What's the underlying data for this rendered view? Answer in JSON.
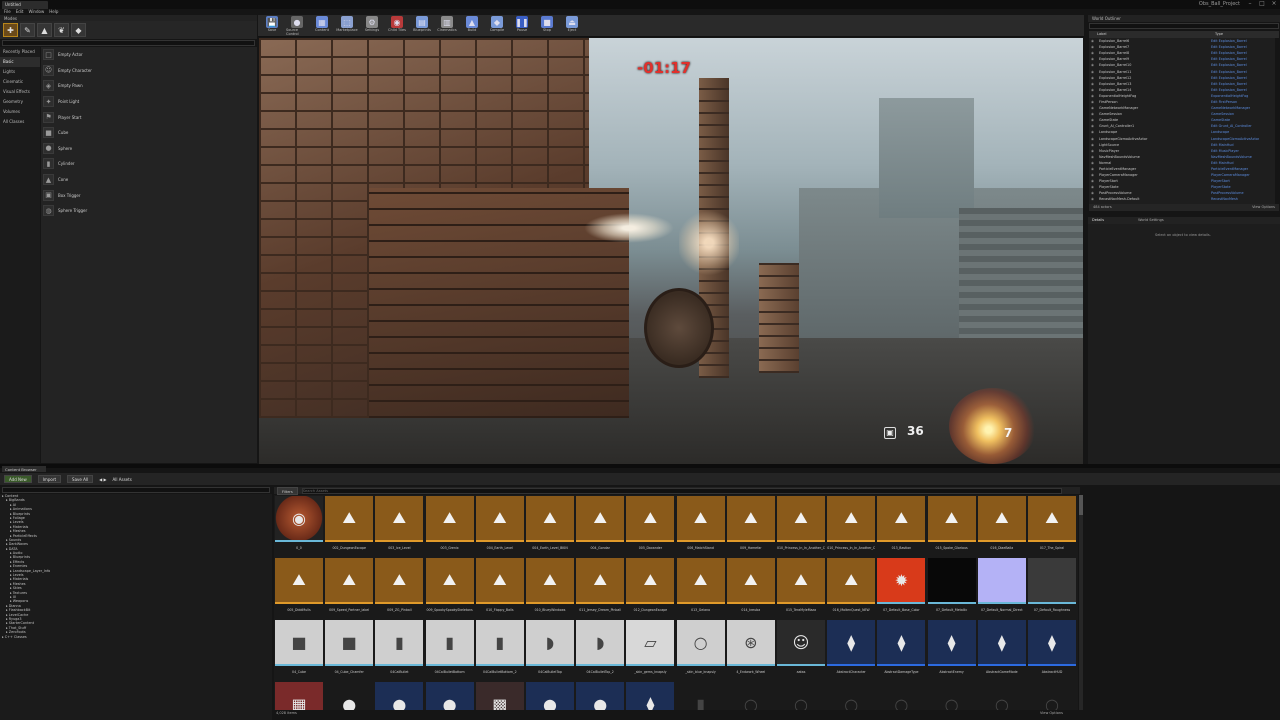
{
  "window": {
    "tab": "Untitled",
    "project": "Obs_Ball_Project",
    "min": "–",
    "max": "□",
    "close": "×"
  },
  "menu": [
    "File",
    "Edit",
    "Window",
    "Help"
  ],
  "modes": {
    "title": "Modes",
    "icons": [
      "place-icon",
      "paint-icon",
      "landscape-icon",
      "foliage-icon",
      "geometry-icon"
    ]
  },
  "place": {
    "categories": [
      "Recently Placed",
      "Basic",
      "Lights",
      "Cinematic",
      "Visual Effects",
      "Geometry",
      "Volumes",
      "All Classes"
    ],
    "selected_index": 1,
    "items": [
      "Empty Actor",
      "Empty Character",
      "Empty Pawn",
      "Point Light",
      "Player Start",
      "Cube",
      "Sphere",
      "Cylinder",
      "Cone",
      "Box Trigger",
      "Sphere Trigger"
    ]
  },
  "toolbar": [
    {
      "label": "Save",
      "color": "#5b7ec4",
      "icon": "💾"
    },
    {
      "label": "Source Control",
      "color": "#666",
      "icon": "●"
    },
    {
      "label": "Content",
      "color": "#6a8ad8",
      "icon": "▦"
    },
    {
      "label": "Marketplace",
      "color": "#8aa0d0",
      "icon": "⬚"
    },
    {
      "label": "Settings",
      "color": "#888",
      "icon": "⚙"
    },
    {
      "label": "Child Tiles",
      "color": "#b83a3a",
      "icon": "◉"
    },
    {
      "label": "Blueprints",
      "color": "#7a9ad8",
      "icon": "▤"
    },
    {
      "label": "Cinematics",
      "color": "#8a8a8a",
      "icon": "▥"
    },
    {
      "label": "Build",
      "color": "#6a8ad8",
      "icon": "▲"
    },
    {
      "label": "Compile",
      "color": "#7a9ad8",
      "icon": "◆"
    },
    {
      "label": "Pause",
      "color": "#3a5ec4",
      "icon": "❚❚"
    },
    {
      "label": "Stop",
      "color": "#5a7ad0",
      "icon": "■"
    },
    {
      "label": "Eject",
      "color": "#7a9ad8",
      "icon": "⏏"
    }
  ],
  "viewport": {
    "timer": "-01:17",
    "ammo": "36",
    "orb_count": "7",
    "ammo_icon": "▣"
  },
  "outliner": {
    "title": "World Outliner",
    "col_label": "Label",
    "col_type": "Type",
    "rows": [
      [
        "Explosion_Barrel6",
        "Edit Explosion_Barrel"
      ],
      [
        "Explosion_Barrel7",
        "Edit Explosion_Barrel"
      ],
      [
        "Explosion_Barrel8",
        "Edit Explosion_Barrel"
      ],
      [
        "Explosion_Barrel9",
        "Edit Explosion_Barrel"
      ],
      [
        "Explosion_Barrel10",
        "Edit Explosion_Barrel"
      ],
      [
        "Explosion_Barrel11",
        "Edit Explosion_Barrel"
      ],
      [
        "Explosion_Barrel12",
        "Edit Explosion_Barrel"
      ],
      [
        "Explosion_Barrel13",
        "Edit Explosion_Barrel"
      ],
      [
        "Explosion_Barrel14",
        "Edit Explosion_Barrel"
      ],
      [
        "ExponentialHeightFog",
        "ExponentialHeightFog"
      ],
      [
        "FirstPerson",
        "Edit FirstPerson"
      ],
      [
        "GameNetworkManager",
        "GameNetworkManager"
      ],
      [
        "GameSession",
        "GameSession"
      ],
      [
        "GameState",
        "GameState"
      ],
      [
        "Grunt_AI_Controller1",
        "Edit Grunt_AI_Controller"
      ],
      [
        "Landscape",
        "Landscape"
      ],
      [
        "LandscapeGizmoActiveActor",
        "LandscapeGizmoActiveActor"
      ],
      [
        "LightSource",
        "Edit MainHud"
      ],
      [
        "MusicPlayer",
        "Edit MusicPlayer"
      ],
      [
        "NavMeshBoundsVolume",
        "NavMeshBoundsVolume"
      ],
      [
        "Normal",
        "Edit MainHud"
      ],
      [
        "ParticleEventManager",
        "ParticleEventManager"
      ],
      [
        "PlayerCameraManager",
        "PlayerCameraManager"
      ],
      [
        "PlayerStart",
        "PlayerStart"
      ],
      [
        "PlayerState",
        "PlayerState"
      ],
      [
        "PostProcessVolume",
        "PostProcessVolume"
      ],
      [
        "RecastNavMesh-Default",
        "RecastNavMesh"
      ],
      [
        "SM_Env_Ins_Buildings_Stairs2",
        "StaticMeshActor"
      ]
    ],
    "footer": "484 actors",
    "view_options": "View Options"
  },
  "details": {
    "tabs": [
      "Details",
      "World Settings"
    ],
    "message": "Select an object to view details."
  },
  "content_browser": {
    "tab": "Content Browser",
    "buttons": [
      "Add New",
      "Import",
      "Save All"
    ],
    "path": "All Assets",
    "tree": [
      "Content",
      "BigBands",
      "AI",
      "Animations",
      "Blueprints",
      "Foliage",
      "Levels",
      "Materials",
      "Meshes",
      "ParticleEffects",
      "Sounds",
      "DarkWaves",
      "DATA",
      "Audio",
      "Blueprints",
      "Effects",
      "Enemies",
      "Landscape_Layer_Info",
      "Levels",
      "Materials",
      "Meshes",
      "Skies",
      "Textures",
      "UI",
      "Weapons",
      "Dianna",
      "FlashbackBit",
      "LevelCache",
      "Ryuga3",
      "StarterContent",
      "That_Stuff",
      "ZeroFoots",
      "C++ Classes"
    ],
    "filter_label": "Filters",
    "search_placeholder": "Search Assets",
    "rows": [
      [
        {
          "label": "0_0",
          "thumb": "sphere-tex",
          "bg": "#7a3c24"
        },
        {
          "label": "002_DungeonEscape",
          "thumb": "map",
          "bg": "#8a5a1a"
        },
        {
          "label": "003_Ice_Level",
          "thumb": "map",
          "bg": "#8a5a1a"
        },
        {
          "label": "003_Grenix",
          "thumb": "map",
          "bg": "#8a5a1a"
        },
        {
          "label": "004_Earth_Level",
          "thumb": "map",
          "bg": "#8a5a1a"
        },
        {
          "label": "004_Earth_Level_BKIN",
          "thumb": "map",
          "bg": "#8a5a1a"
        },
        {
          "label": "004_Gondar",
          "thumb": "map",
          "bg": "#8a5a1a"
        },
        {
          "label": "005_Daxander",
          "thumb": "map",
          "bg": "#8a5a1a"
        },
        {
          "label": "006_MatchStand",
          "thumb": "map",
          "bg": "#8a5a1a"
        },
        {
          "label": "009_Hamefar",
          "thumb": "map",
          "bg": "#8a5a1a"
        },
        {
          "label": "010_Princess_In_In_Another_Castle",
          "thumb": "map",
          "bg": "#8a5a1a"
        },
        {
          "label": "010_Princess_In_In_Another_Castle",
          "thumb": "map",
          "bg": "#8a5a1a"
        },
        {
          "label": "013_Bastion",
          "thumb": "map",
          "bg": "#8a5a1a"
        },
        {
          "label": "015_Spoke_Glorious",
          "thumb": "map",
          "bg": "#8a5a1a"
        },
        {
          "label": "016_DiaeBalla",
          "thumb": "map",
          "bg": "#8a5a1a"
        },
        {
          "label": "017_The_Spiral",
          "thumb": "map",
          "bg": "#8a5a1a"
        }
      ],
      [
        {
          "label": "005_DiddMulls",
          "thumb": "map",
          "bg": "#8a5a1a"
        },
        {
          "label": "009_Speed_Partner_label",
          "thumb": "map",
          "bg": "#8a5a1a"
        },
        {
          "label": "009_ZG_Pinball",
          "thumb": "map",
          "bg": "#8a5a1a"
        },
        {
          "label": "009_SpookySpookySkeletons",
          "thumb": "map",
          "bg": "#8a5a1a"
        },
        {
          "label": "010_Floppy_Balls",
          "thumb": "map",
          "bg": "#8a5a1a"
        },
        {
          "label": "010_BlueyWindows",
          "thumb": "map",
          "bg": "#8a5a1a"
        },
        {
          "label": "011_Jersey_Dream_Pinball",
          "thumb": "map",
          "bg": "#8a5a1a"
        },
        {
          "label": "012_DungeonEscape",
          "thumb": "map",
          "bg": "#8a5a1a"
        },
        {
          "label": "013_Geiano",
          "thumb": "map",
          "bg": "#8a5a1a"
        },
        {
          "label": "014_kreuba",
          "thumb": "map",
          "bg": "#8a5a1a"
        },
        {
          "label": "015_TeraMyleMaza",
          "thumb": "map",
          "bg": "#8a5a1a"
        },
        {
          "label": "016_MoltenQuest_NEW",
          "thumb": "map",
          "bg": "#8a5a1a"
        },
        {
          "label": "07_Default_Base_Color",
          "thumb": "fire",
          "bg": "#d83a1a"
        },
        {
          "label": "07_Default_Metallic",
          "thumb": "dark",
          "bg": "#080808"
        },
        {
          "label": "07_Default_Normal_Direct",
          "thumb": "normal",
          "bg": "#b4b2f6"
        },
        {
          "label": "07_Default_Roughness",
          "thumb": "grey",
          "bg": "#3a3a3a"
        }
      ],
      [
        {
          "label": "04_Cube",
          "thumb": "cube",
          "bg": "#cfcfcf"
        },
        {
          "label": "04_Cube_Chamfer",
          "thumb": "cube",
          "bg": "#cfcfcf"
        },
        {
          "label": "04CalBullet",
          "thumb": "cyl",
          "bg": "#cfcfcf"
        },
        {
          "label": "04CalBulletBottom",
          "thumb": "cyl",
          "bg": "#cfcfcf"
        },
        {
          "label": "04CalBulletBottom_2",
          "thumb": "cyl",
          "bg": "#cfcfcf"
        },
        {
          "label": "04CalBulletTop",
          "thumb": "dome",
          "bg": "#cfcfcf"
        },
        {
          "label": "04CalBulletTop_2",
          "thumb": "dome",
          "bg": "#cfcfcf"
        },
        {
          "label": "_skin_gems_knapsly",
          "thumb": "plane",
          "bg": "#d8d8d8"
        },
        {
          "label": "_skin_blue_knapsly",
          "thumb": "ring",
          "bg": "#cfcfcf"
        },
        {
          "label": "4_Endwork_Wheel",
          "thumb": "wheel",
          "bg": "#cfcfcf"
        },
        {
          "label": "aatas",
          "thumb": "face",
          "bg": "#2a2a2a"
        },
        {
          "label": "AbstractCharacter",
          "thumb": "bp",
          "bg": "#1c2e55"
        },
        {
          "label": "AbstractDamageType",
          "thumb": "bp",
          "bg": "#1c2e55"
        },
        {
          "label": "AbstractEnemy",
          "thumb": "bp",
          "bg": "#1c2e55"
        },
        {
          "label": "AbstractGameMode",
          "thumb": "bp",
          "bg": "#1c2e55"
        },
        {
          "label": "AbstractHUD",
          "thumb": "bp",
          "bg": "#1c2e55"
        }
      ],
      [
        {
          "label": "",
          "thumb": "brick",
          "bg": "#7a2a2a"
        },
        {
          "label": "",
          "thumb": "sphere",
          "bg": "#1a1a1a"
        },
        {
          "label": "",
          "thumb": "sphere",
          "bg": "#1c2e55"
        },
        {
          "label": "",
          "thumb": "sphere",
          "bg": "#1c2e55"
        },
        {
          "label": "",
          "thumb": "tex",
          "bg": "#3a2a2a"
        },
        {
          "label": "",
          "thumb": "sphere",
          "bg": "#1c2e55"
        },
        {
          "label": "",
          "thumb": "sphere",
          "bg": "#1c2e55"
        },
        {
          "label": "",
          "thumb": "bp",
          "bg": "#1c2e55"
        },
        {
          "label": "",
          "thumb": "cyl",
          "bg": "#1a1a1a"
        },
        {
          "label": "",
          "thumb": "ring",
          "bg": "#1a1a1a"
        },
        {
          "label": "",
          "thumb": "ring",
          "bg": "#1a1a1a"
        },
        {
          "label": "",
          "thumb": "ring",
          "bg": "#1a1a1a"
        },
        {
          "label": "",
          "thumb": "ring",
          "bg": "#1a1a1a"
        },
        {
          "label": "",
          "thumb": "ring",
          "bg": "#1a1a1a"
        },
        {
          "label": "",
          "thumb": "ring",
          "bg": "#1a1a1a"
        },
        {
          "label": "",
          "thumb": "ring",
          "bg": "#1a1a1a"
        }
      ]
    ],
    "item_count": "4,028 items",
    "view_options": "View Options"
  }
}
